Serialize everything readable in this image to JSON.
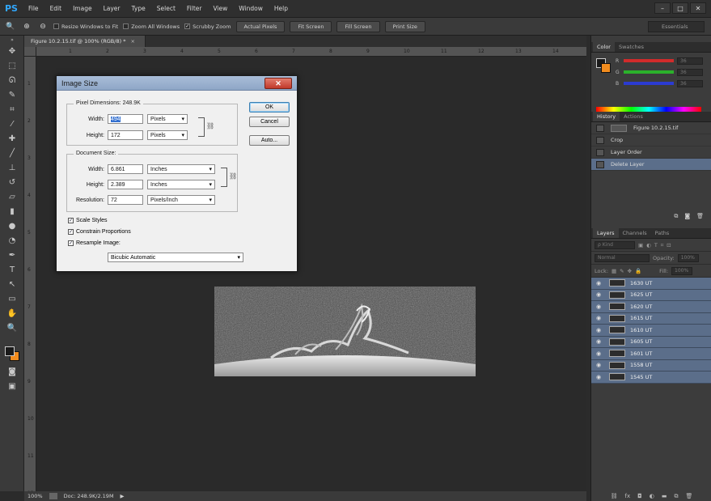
{
  "app": {
    "logo": "PS"
  },
  "menu": [
    "File",
    "Edit",
    "Image",
    "Layer",
    "Type",
    "Select",
    "Filter",
    "View",
    "Window",
    "Help"
  ],
  "window_controls": [
    "–",
    "□",
    "✕"
  ],
  "options_bar": {
    "resize_windows": "Resize Windows to Fit",
    "zoom_all": "Zoom All Windows",
    "scrubby_zoom": "Scrubby Zoom",
    "buttons": [
      "Actual Pixels",
      "Fit Screen",
      "Fill Screen",
      "Print Size"
    ],
    "workspace": "Essentials"
  },
  "document_tab": {
    "title": "Figure 10.2.15.tif @ 100% (RGB/8) *",
    "close": "×"
  },
  "ruler": {
    "h_labels": [
      "1",
      "2",
      "3",
      "4",
      "5",
      "6",
      "7",
      "8",
      "9",
      "10",
      "11",
      "12",
      "13",
      "14",
      "15"
    ],
    "v_labels": [
      "1",
      "2",
      "3",
      "4",
      "5",
      "6",
      "7",
      "8",
      "9",
      "10",
      "11",
      "12"
    ]
  },
  "status": {
    "zoom": "100%",
    "doc": "Doc: 248.9K/2.19M",
    "arrow": "▶"
  },
  "color_panel": {
    "tabs": [
      "Color",
      "Swatches"
    ],
    "channels": [
      {
        "label": "R",
        "value": "36",
        "color": "#d12b2b"
      },
      {
        "label": "G",
        "value": "36",
        "color": "#2bb12b"
      },
      {
        "label": "B",
        "value": "36",
        "color": "#2b3bd1"
      }
    ],
    "fg_color": "#1a1a1a",
    "bg_color": "#f28c1e"
  },
  "history_panel": {
    "tabs": [
      "History",
      "Actions"
    ],
    "snapshot": "Figure 10.2.15.tif",
    "items": [
      {
        "label": "Crop"
      },
      {
        "label": "Layer Order"
      },
      {
        "label": "Delete Layer"
      }
    ]
  },
  "layers_panel": {
    "tabs": [
      "Layers",
      "Channels",
      "Paths"
    ],
    "kind": "ρ Kind",
    "blend_mode": "Normal",
    "opacity_label": "Opacity:",
    "opacity_value": "100%",
    "lock_label": "Lock:",
    "fill_label": "Fill:",
    "fill_value": "100%",
    "layers": [
      "1630 UT",
      "1625 UT",
      "1620 UT",
      "1615 UT",
      "1610 UT",
      "1605 UT",
      "1601 UT",
      "1558 UT",
      "1545 UT"
    ]
  },
  "dialog": {
    "title": "Image Size",
    "close": "✕",
    "pixel_dimensions_label": "Pixel Dimensions:",
    "pixel_dimensions_value": "248.9K",
    "width_label": "Width:",
    "height_label": "Height:",
    "px_width": "494",
    "px_height": "172",
    "px_unit": "Pixels",
    "document_size_label": "Document Size:",
    "doc_width": "6.861",
    "doc_height": "2.389",
    "doc_unit": "Inches",
    "resolution_label": "Resolution:",
    "resolution": "72",
    "resolution_unit": "Pixels/Inch",
    "buttons": {
      "ok": "OK",
      "cancel": "Cancel",
      "auto": "Auto..."
    },
    "checks": [
      "Scale Styles",
      "Constrain Proportions",
      "Resample Image:"
    ],
    "resample_method": "Bicubic Automatic",
    "dropdown_arrow": "▾"
  }
}
